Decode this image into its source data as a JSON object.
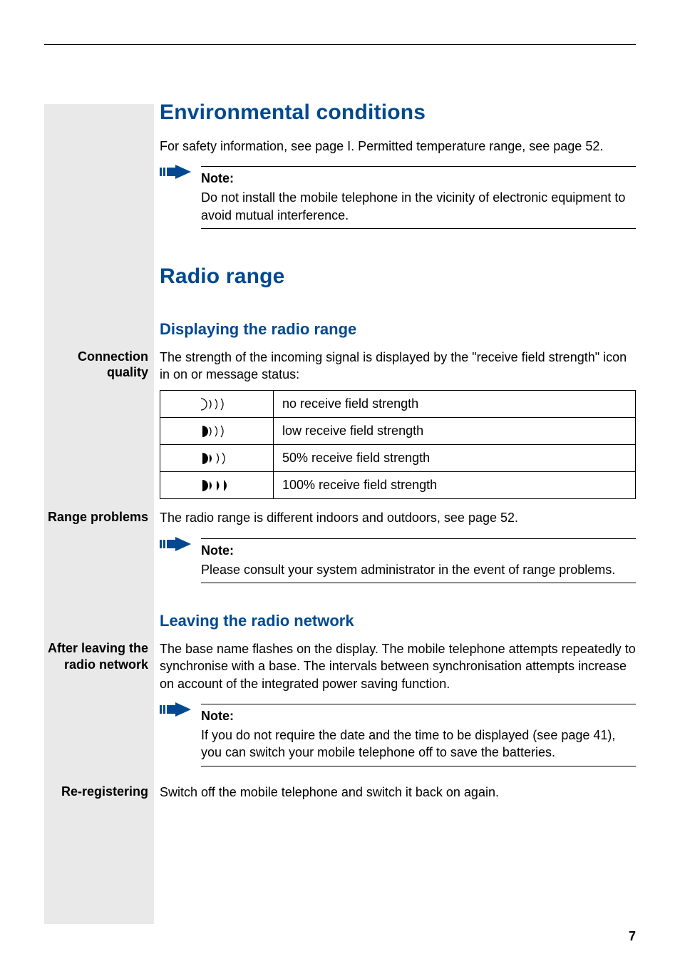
{
  "page_number": "7",
  "h1_env": "Environmental conditions",
  "p_env_intro": "For safety information, see page I. Permitted temperature range, see page 52.",
  "note_label": "Note:",
  "note_env": "Do not install the mobile telephone in the vicinity of electronic equipment to avoid mutual interference.",
  "h1_radio": "Radio range",
  "h2_display": "Displaying the radio range",
  "label_conn_quality_l1": "Connection",
  "label_conn_quality_l2": "quality",
  "p_conn_quality": "The strength of the incoming signal is displayed by the \"receive field strength\" icon in on or message status:",
  "sig_rows": [
    {
      "desc": "no receive field strength"
    },
    {
      "desc": "low receive field strength"
    },
    {
      "desc": "50% receive field strength"
    },
    {
      "desc": "100% receive field strength"
    }
  ],
  "label_range_problems": "Range problems",
  "p_range_problems": "The radio range is different indoors and outdoors, see page 52.",
  "note_range": "Please consult your system administrator in the event of range problems.",
  "h2_leaving": "Leaving the radio network",
  "label_after_leaving_l1": "After leaving the",
  "label_after_leaving_l2": "radio network",
  "p_after_leaving": "The base name flashes on the display. The mobile telephone attempts repeatedly to synchronise with a base. The intervals between synchronisation attempts increase on account of the integrated power saving function.",
  "note_leaving": "If you do not require the date and the time to be displayed (see page 41), you can switch your mobile telephone off to save the batteries.",
  "label_rereg": "Re-registering",
  "p_rereg": "Switch off the mobile telephone and switch it back on again.",
  "colors": {
    "brand_blue": "#004990",
    "sidebar_grey": "#e9e9e9"
  }
}
